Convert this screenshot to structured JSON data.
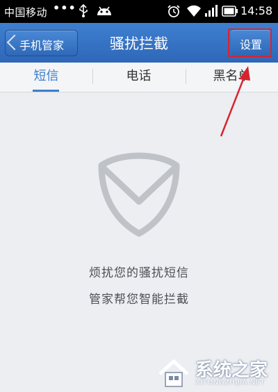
{
  "status_bar": {
    "carrier": "中国移动",
    "dots": "•••",
    "time": "14:58",
    "icons": [
      "usb-icon",
      "android-icon",
      "alarm-icon",
      "wifi-icon",
      "signal-icon",
      "battery-icon"
    ]
  },
  "header": {
    "back_label": "手机管家",
    "title": "骚扰拦截",
    "settings_label": "设置"
  },
  "tabs": [
    {
      "label": "短信",
      "active": true
    },
    {
      "label": "电话",
      "active": false
    },
    {
      "label": "黑名单",
      "active": false
    }
  ],
  "empty_state": {
    "line1": "烦扰您的骚扰短信",
    "line2": "管家帮您智能拦截",
    "icon": "shield-icon"
  },
  "colors": {
    "header_blue": "#3f7fd0",
    "tab_active": "#3c7fcc",
    "annotation_red": "#d8232f"
  },
  "watermark": {
    "title": "系统之家",
    "url": "XITONGZHIJIA.NET"
  }
}
